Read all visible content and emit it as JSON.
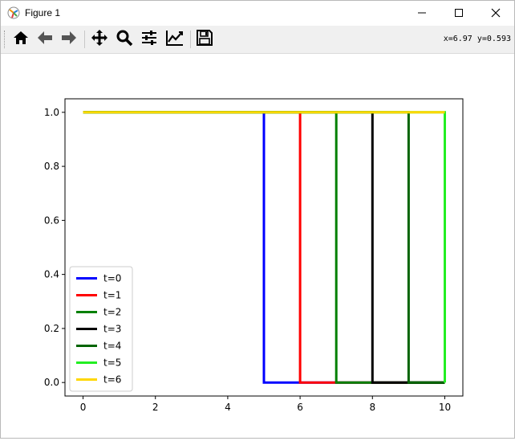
{
  "window": {
    "title": "Figure 1",
    "app_icon": "matplotlib-icon",
    "controls": [
      "minimize-icon",
      "maximize-icon",
      "close-icon"
    ]
  },
  "toolbar": {
    "tools": [
      {
        "name": "home",
        "icon": "home-icon"
      },
      {
        "name": "back",
        "icon": "arrow-left-icon"
      },
      {
        "name": "forward",
        "icon": "arrow-right-icon"
      },
      {
        "name": "pan",
        "icon": "move-icon"
      },
      {
        "name": "zoom",
        "icon": "magnifier-icon"
      },
      {
        "name": "subplots",
        "icon": "sliders-icon"
      },
      {
        "name": "edit",
        "icon": "chart-line-icon"
      },
      {
        "name": "save",
        "icon": "floppy-disk-icon"
      }
    ],
    "coords_text": "x=6.97 y=0.593"
  },
  "chart_data": {
    "type": "line",
    "title": "",
    "xlabel": "",
    "ylabel": "",
    "xlim": [
      -0.5,
      10.5
    ],
    "ylim": [
      -0.05,
      1.05
    ],
    "xticks": [
      0,
      2,
      4,
      6,
      8,
      10
    ],
    "yticks": [
      0.0,
      0.2,
      0.4,
      0.6,
      0.8,
      1.0
    ],
    "xtick_labels": [
      "0",
      "2",
      "4",
      "6",
      "8",
      "10"
    ],
    "ytick_labels": [
      "0.0",
      "0.2",
      "0.4",
      "0.6",
      "0.8",
      "1.0"
    ],
    "grid": false,
    "legend": "lower-left",
    "series": [
      {
        "name": "t=0",
        "color": "#0000ff",
        "x": [
          0,
          5,
          5,
          10
        ],
        "y": [
          1,
          1,
          0,
          0
        ]
      },
      {
        "name": "t=1",
        "color": "#ff0000",
        "x": [
          0,
          6,
          6,
          10
        ],
        "y": [
          1,
          1,
          0,
          0
        ]
      },
      {
        "name": "t=2",
        "color": "#008000",
        "x": [
          0,
          7,
          7,
          10
        ],
        "y": [
          1,
          1,
          0,
          0
        ]
      },
      {
        "name": "t=3",
        "color": "#000000",
        "x": [
          0,
          8,
          8,
          10
        ],
        "y": [
          1,
          1,
          0,
          0
        ]
      },
      {
        "name": "t=4",
        "color": "#006400",
        "x": [
          0,
          9,
          9,
          10
        ],
        "y": [
          1,
          1,
          0,
          0
        ]
      },
      {
        "name": "t=5",
        "color": "#22ee22",
        "x": [
          0,
          10,
          10,
          10
        ],
        "y": [
          1,
          1,
          0,
          0
        ]
      },
      {
        "name": "t=6",
        "color": "#ffd700",
        "x": [
          0,
          10
        ],
        "y": [
          1,
          1
        ]
      }
    ]
  }
}
